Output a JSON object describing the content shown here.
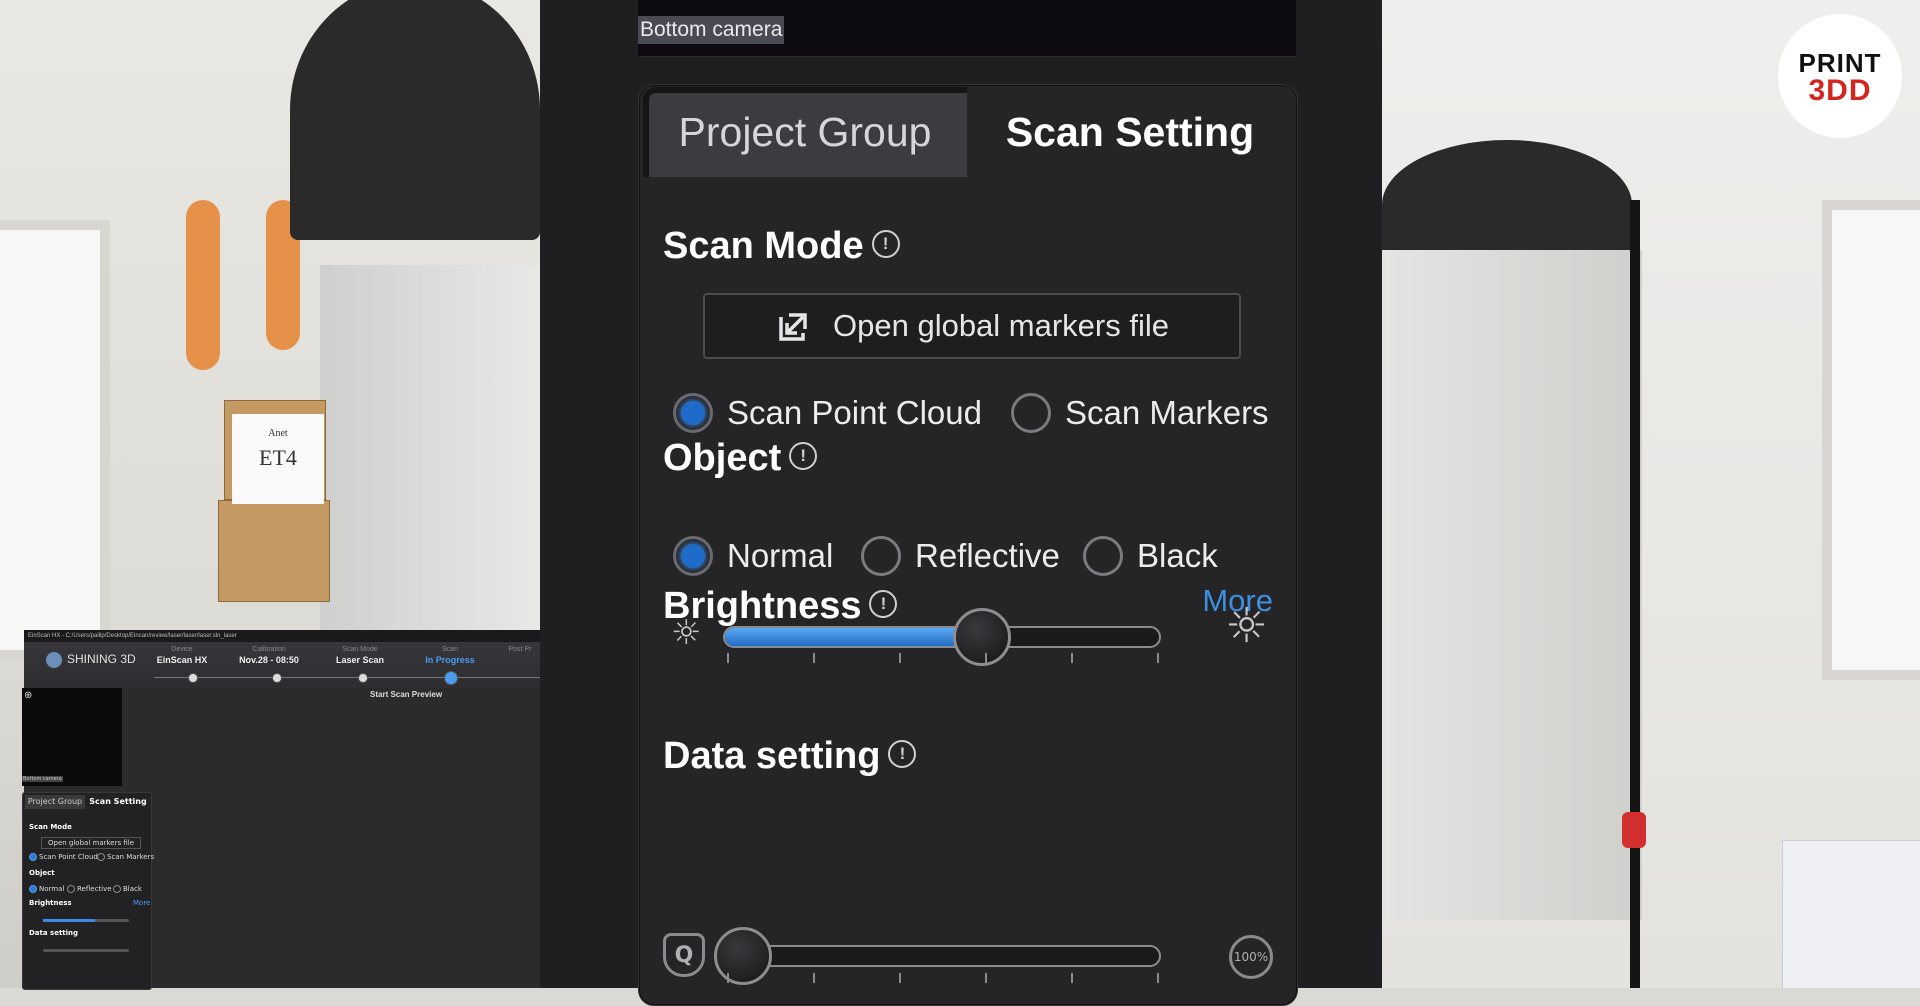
{
  "camera": {
    "label": "Bottom camera"
  },
  "tabs": [
    {
      "label": "Project Group",
      "active": false
    },
    {
      "label": "Scan Setting",
      "active": true
    }
  ],
  "scan_mode": {
    "title": "Scan Mode",
    "markers_button": "Open global markers file",
    "options": [
      {
        "label": "Scan Point Cloud",
        "selected": true
      },
      {
        "label": "Scan Markers",
        "selected": false
      }
    ]
  },
  "object": {
    "title": "Object",
    "options": [
      {
        "label": "Normal",
        "selected": true
      },
      {
        "label": "Reflective",
        "selected": false
      },
      {
        "label": "Black",
        "selected": false
      }
    ]
  },
  "brightness": {
    "title": "Brightness",
    "more": "More",
    "level": 0.6
  },
  "data_setting": {
    "title": "Data setting",
    "level": 0.0,
    "left_icon": "Q",
    "right_icon": "100%"
  },
  "mini_app": {
    "path": "EinScan HX  -  C:/Users/pailip/Desktop/Eincan/review/laser/laser/laser.sln_laser",
    "logo": "SHINING 3D",
    "steps": [
      {
        "label": "Device",
        "value": "EinScan HX"
      },
      {
        "label": "Calibration",
        "value": "Nov.28 - 08:50"
      },
      {
        "label": "Scan Mode",
        "value": "Laser Scan"
      },
      {
        "label": "Scan",
        "value": "In Progress"
      },
      {
        "label": "Post Pr",
        "value": ""
      }
    ],
    "preview_button": "Start Scan Preview",
    "camera_label": "Bottom camera",
    "tabs": [
      "Project Group",
      "Scan Setting"
    ],
    "scan_mode": "Scan Mode",
    "markers_button": "Open global markers file",
    "scan_options": [
      "Scan Point Cloud",
      "Scan Markers"
    ],
    "object": "Object",
    "object_options": [
      "Normal",
      "Reflective",
      "Black"
    ],
    "brightness": "Brightness",
    "more": "More",
    "data_setting": "Data setting"
  },
  "background": {
    "box_label_top": "Anet",
    "box_label_model": "ET4"
  },
  "watermark": {
    "top": "PRINT",
    "bottom": "3DD"
  },
  "colors": {
    "accent": "#1e6bc9",
    "link": "#3d8fe0",
    "panel": "#252528",
    "watermark_red": "#d6241f"
  }
}
